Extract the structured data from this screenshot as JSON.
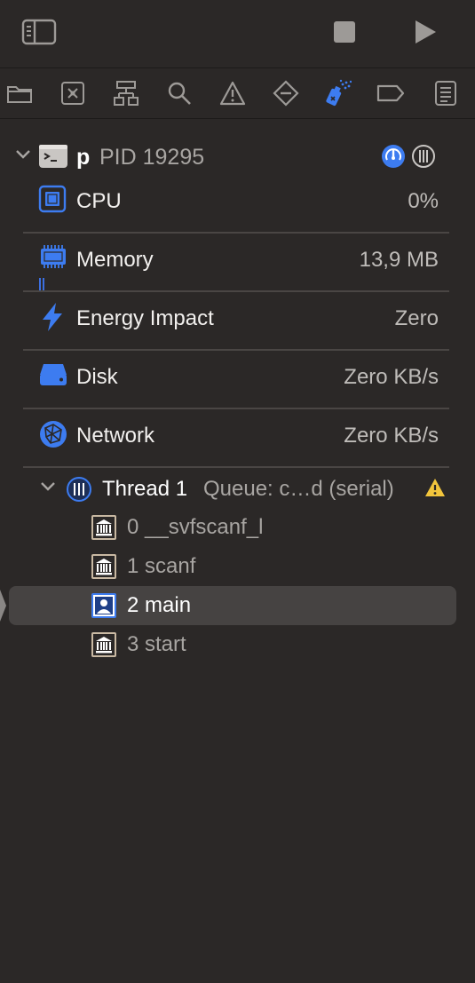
{
  "toolbar": {
    "sidebar_icon": "sidebar-toggle-icon",
    "stop_icon": "stop-icon",
    "run_icon": "run-play-icon"
  },
  "navigator": {
    "icons": [
      "folder-icon",
      "source-control-icon",
      "hierarchy-icon",
      "search-icon",
      "warning-icon",
      "test-diamond-icon",
      "debug-spray-icon",
      "breakpoint-tag-icon",
      "report-list-icon"
    ],
    "active_index": 6,
    "accent": "#3d7cf0"
  },
  "process": {
    "name": "p",
    "pid": "PID 19295"
  },
  "gauges": [
    {
      "label": "CPU",
      "value": "0%",
      "icon": "cpu-icon"
    },
    {
      "label": "Memory",
      "value": "13,9 MB",
      "icon": "memory-icon"
    },
    {
      "label": "Energy Impact",
      "value": "Zero",
      "icon": "energy-bolt-icon"
    },
    {
      "label": "Disk",
      "value": "Zero KB/s",
      "icon": "disk-icon"
    },
    {
      "label": "Network",
      "value": "Zero KB/s",
      "icon": "network-globe-icon"
    }
  ],
  "thread": {
    "name": "Thread 1",
    "queue": "Queue: c…d (serial)"
  },
  "frames": [
    {
      "label": "0 __svfscanf_l",
      "icon": "library-frame-icon"
    },
    {
      "label": "1 scanf",
      "icon": "library-frame-icon"
    },
    {
      "label": "2 main",
      "icon": "user-frame-icon"
    },
    {
      "label": "3 start",
      "icon": "library-frame-icon"
    }
  ],
  "selected_frame": 2
}
